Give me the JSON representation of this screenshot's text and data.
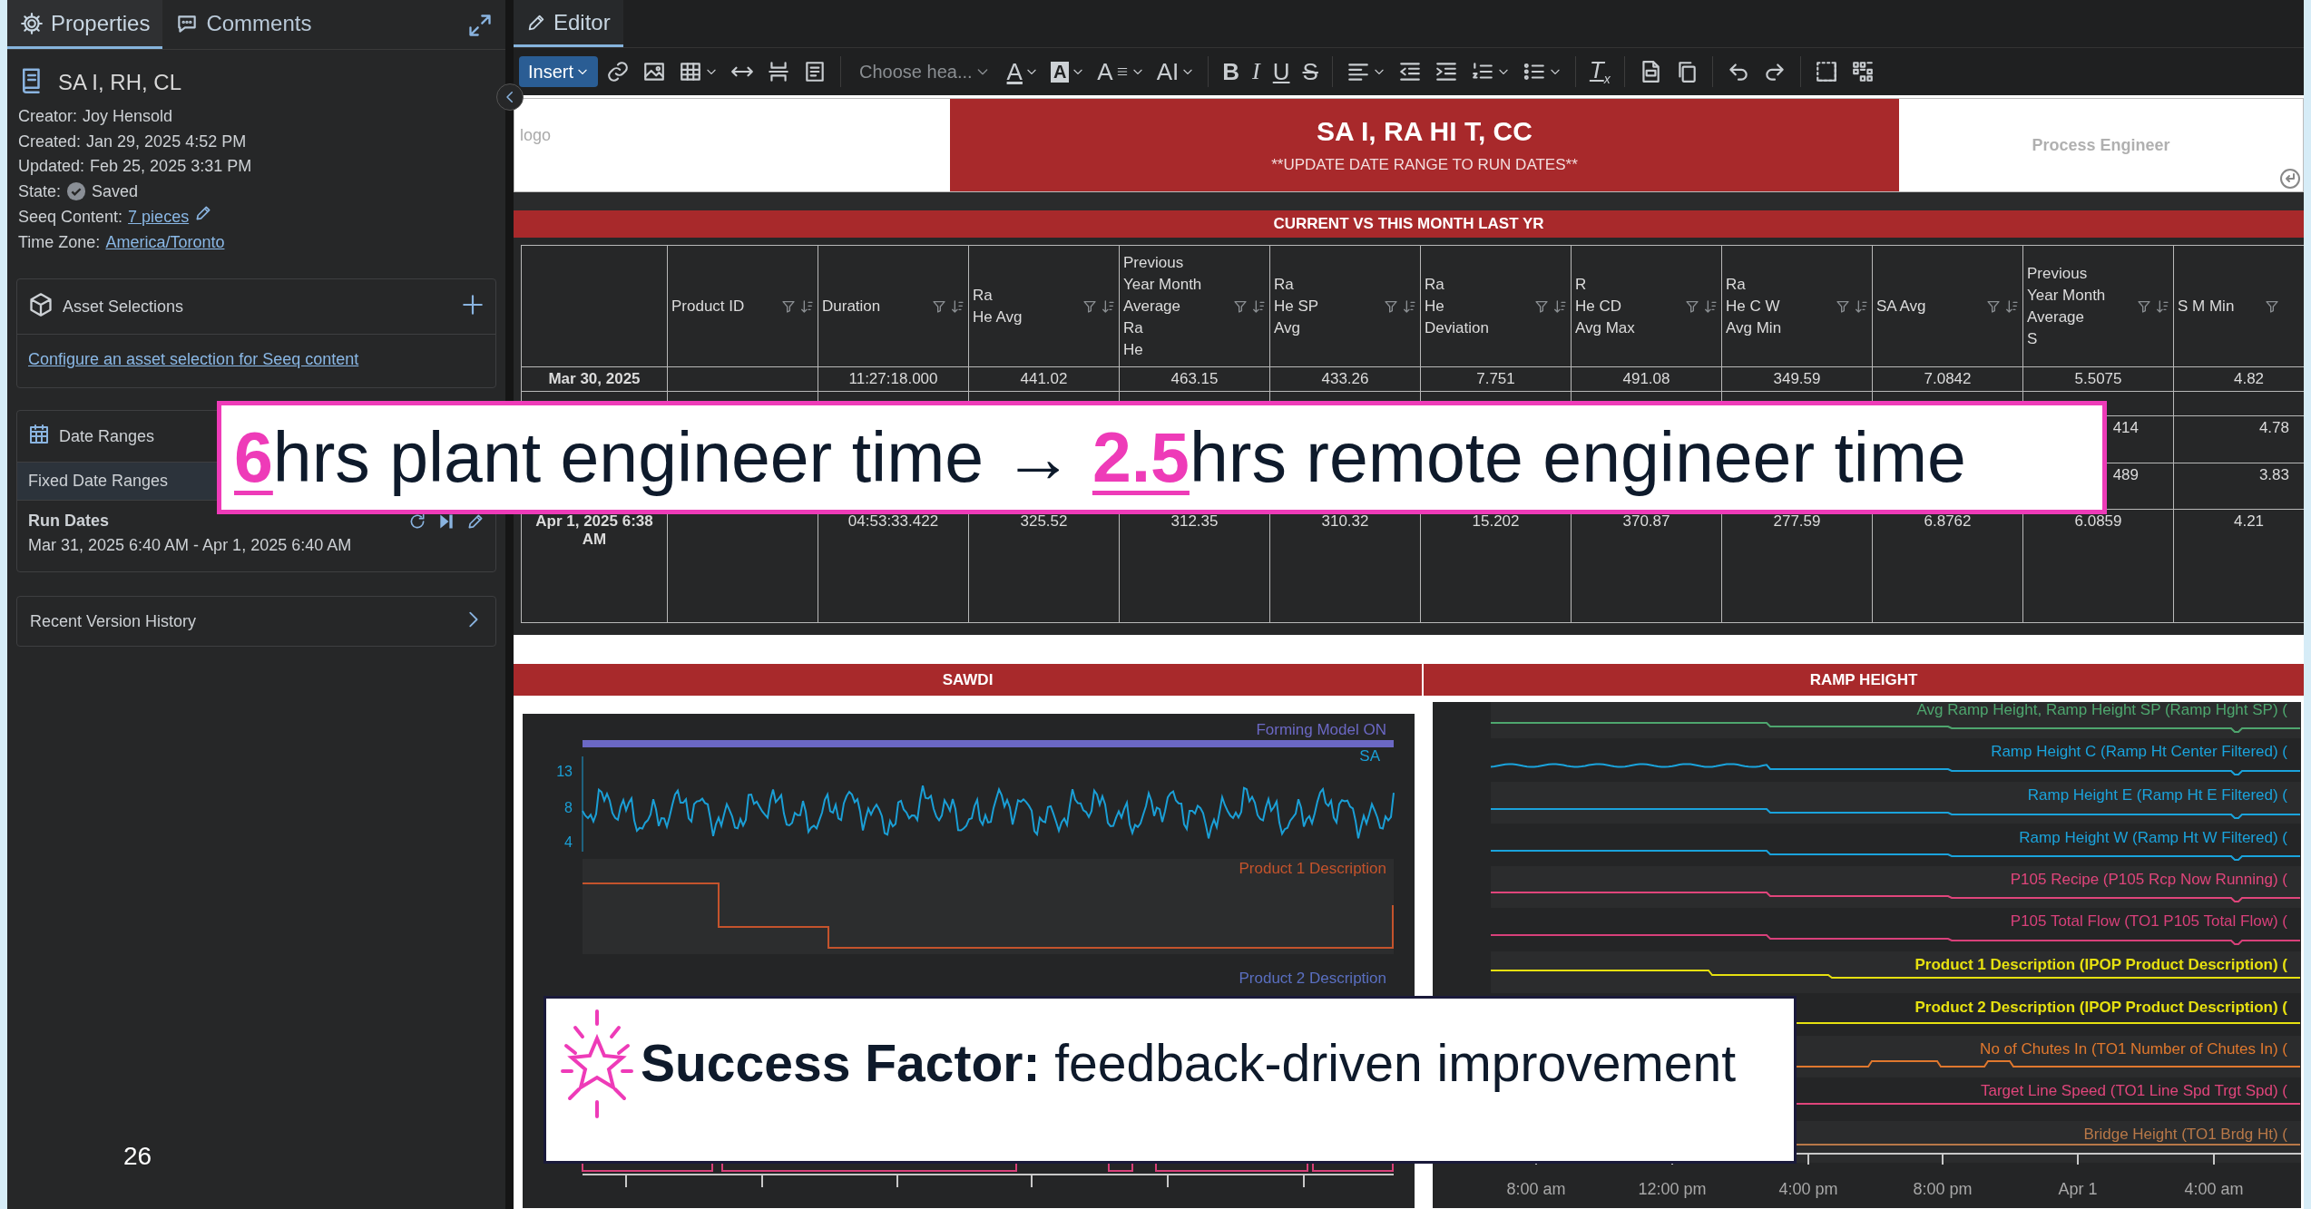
{
  "left_panel": {
    "tabs": [
      {
        "label": "Properties",
        "selected": true
      },
      {
        "label": "Comments",
        "selected": false
      }
    ],
    "title": "SA I, RH, CL",
    "meta": [
      {
        "label": "Creator:",
        "value": "Joy Hensold",
        "kind": "text"
      },
      {
        "label": "Created:",
        "value": "Jan 29, 2025 4:52 PM",
        "kind": "text"
      },
      {
        "label": "Updated:",
        "value": "Feb 25, 2025 3:31 PM",
        "kind": "text"
      },
      {
        "label": "State:",
        "value": "Saved",
        "kind": "state"
      },
      {
        "label": "Seeq Content:",
        "value": "7 pieces",
        "kind": "link_edit"
      },
      {
        "label": "Time Zone:",
        "value": "America/Toronto",
        "kind": "link"
      }
    ],
    "asset_selections": {
      "title": "Asset Selections",
      "link": "Configure an asset selection for Seeq content"
    },
    "date_ranges": {
      "title": "Date Ranges",
      "group": "Fixed Date Ranges",
      "items": [
        {
          "name": "Run Dates",
          "range": "Mar 31, 2025 6:40 AM - Apr 1, 2025 6:40 AM"
        }
      ]
    },
    "version_history": "Recent Version History"
  },
  "page_number": "26",
  "editor": {
    "tab": "Editor",
    "toolbar": [
      {
        "kind": "dropdown",
        "label": "Insert"
      },
      {
        "kind": "icon"
      },
      {
        "kind": "icon"
      },
      {
        "kind": "icon_menu"
      },
      {
        "kind": "icon"
      },
      {
        "kind": "icon"
      },
      {
        "kind": "icon"
      },
      {
        "kind": "separator"
      },
      {
        "kind": "select",
        "label": "Choose hea..."
      },
      {
        "kind": "letter_menu",
        "label": "A"
      },
      {
        "kind": "letter_menu",
        "label": "A"
      },
      {
        "kind": "letter_menu",
        "label": "A"
      },
      {
        "kind": "letter_menu",
        "label": "AI"
      },
      {
        "kind": "separator"
      },
      {
        "kind": "letter",
        "label": "B"
      },
      {
        "kind": "letter",
        "label": "I"
      },
      {
        "kind": "letter",
        "label": "U"
      },
      {
        "kind": "letter",
        "label": "S"
      },
      {
        "kind": "separator"
      },
      {
        "kind": "icon_menu"
      },
      {
        "kind": "icon"
      },
      {
        "kind": "icon"
      },
      {
        "kind": "icon_menu"
      },
      {
        "kind": "icon_menu"
      },
      {
        "kind": "separator"
      },
      {
        "kind": "letter",
        "label": "T$_{x}$"
      },
      {
        "kind": "separator"
      },
      {
        "kind": "icon"
      },
      {
        "kind": "icon"
      },
      {
        "kind": "separator"
      },
      {
        "kind": "icon"
      },
      {
        "kind": "icon"
      },
      {
        "kind": "separator"
      },
      {
        "kind": "icon"
      },
      {
        "kind": "icon"
      }
    ]
  },
  "document": {
    "header": {
      "logo": "logo",
      "title": "SA I, RA HI T, CC",
      "subtitle": "**UPDATE DATE RANGE TO RUN DATES**",
      "role": "Process Engineer"
    },
    "table": {
      "title": "CURRENT VS THIS MONTH LAST YR",
      "columns": [
        {
          "lines": [
            "Product ID"
          ]
        },
        {
          "lines": [
            "Duration"
          ]
        },
        {
          "lines": [
            "Ra",
            "He Avg"
          ]
        },
        {
          "lines": [
            "Previous",
            "Year Month",
            "Average",
            "Ra",
            "He"
          ]
        },
        {
          "lines": [
            "Ra",
            "He SP",
            "Avg"
          ]
        },
        {
          "lines": [
            "Ra",
            "He",
            "Deviation"
          ]
        },
        {
          "lines": [
            "R",
            "He CD",
            "Avg Max"
          ]
        },
        {
          "lines": [
            "Ra",
            "He C W",
            "Avg Min"
          ]
        },
        {
          "lines": [
            "SA Avg"
          ]
        },
        {
          "lines": [
            "Previous",
            "Year Month",
            "Average",
            "S"
          ]
        },
        {
          "lines": [
            "S M Min"
          ]
        }
      ],
      "rows": [
        {
          "label": "Mar 30, 2025",
          "cells": [
            null,
            "11:27:18.000",
            "441.02",
            "463.15",
            "433.26",
            "7.751",
            "491.08",
            "349.59",
            "7.0842",
            "5.5075",
            "4.82"
          ]
        },
        {
          "cells": [
            null,
            null,
            null,
            null,
            null,
            null,
            null,
            null,
            null,
            null,
            null
          ]
        },
        {
          "cells": [
            null,
            null,
            null,
            null,
            null,
            null,
            null,
            null,
            null,
            "414",
            "4.78"
          ]
        },
        {
          "cells": [
            null,
            null,
            null,
            null,
            null,
            null,
            null,
            null,
            null,
            "489",
            "3.83"
          ]
        },
        {
          "label": "Apr 1, 2025 6:38 AM",
          "cells": [
            null,
            "04:53:33.422",
            "325.52",
            "312.35",
            "310.32",
            "15.202",
            "370.87",
            "277.59",
            "6.8762",
            "6.0859",
            "4.21"
          ]
        }
      ]
    },
    "charts": [
      {
        "title": "SAWDI",
        "lanes": [
          {
            "label": "Forming Model ON",
            "color": "#6b68c4",
            "kind": "bar"
          },
          {
            "label": "SA",
            "color": "#1a9fd6",
            "kind": "signal",
            "ticks": [
              "13",
              "8",
              "4"
            ]
          },
          {
            "label": "Product 1 Description",
            "color": "#c4532c",
            "kind": "step"
          },
          {
            "label": "Product 2 Description",
            "color": "#5a6fc0",
            "kind": "capsules"
          }
        ]
      },
      {
        "title": "RAMP HEIGHT",
        "lanes": [
          {
            "label": "Avg Ramp Height, Ramp Height SP (Ramp Hght SP) (",
            "color": "#4ea66e"
          },
          {
            "label": "Ramp Height C (Ramp Ht Center Filtered) (",
            "color": "#1aa3dc"
          },
          {
            "label": "Ramp Height E (Ramp Ht E Filtered) (",
            "color": "#1aa3dc"
          },
          {
            "label": "Ramp Height W (Ramp Ht W Filtered) (",
            "color": "#1aa3dc"
          },
          {
            "label": "P105 Recipe (P105 Rcp Now Running) (",
            "color": "#e0457b"
          },
          {
            "label": "P105 Total Flow (TO1 P105 Total Flow) (",
            "color": "#d8407a"
          },
          {
            "label": "Product 1 Description (IPOP Product Description) (",
            "color": "#e6e010"
          },
          {
            "label": "Product 2 Description (IPOP Product Description) (",
            "color": "#e6e010"
          },
          {
            "label": "No of Chutes In (TO1 Number of Chutes In) (",
            "color": "#e0782e"
          },
          {
            "label": "Target Line Speed (TO1 Line Spd Trgt Spd) (",
            "color": "#e0457b"
          },
          {
            "label": "Bridge Height (TO1 Brdg Ht) (",
            "color": "#b87848"
          }
        ],
        "x_ticks": [
          "8:00 am",
          "12:00 pm",
          "4:00 pm",
          "8:00 pm",
          "Apr 1",
          "4:00 am"
        ]
      }
    ]
  },
  "callouts": [
    {
      "kind": "metric",
      "text": "**6**hrs plant engineer time → **2.5**hrs remote engineer time"
    },
    {
      "kind": "success",
      "text": "**Success Factor:** feedback-driven improvement"
    }
  ]
}
